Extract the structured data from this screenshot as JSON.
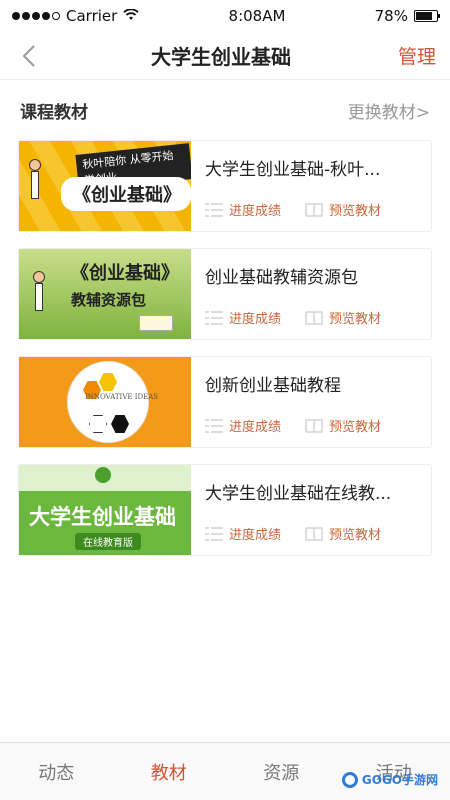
{
  "status": {
    "carrier": "Carrier",
    "time": "8:08AM",
    "battery": "78%",
    "battery_level": 0.78
  },
  "nav": {
    "title": "大学生创业基础",
    "manage": "管理"
  },
  "section": {
    "title": "课程教材",
    "switch": "更换教材>"
  },
  "actions": {
    "progress": "进度成绩",
    "preview": "预览教材"
  },
  "books": [
    {
      "title": "大学生创业基础-秋叶...",
      "cover_banner": "秋叶陪你 从零开始学创业",
      "cover_badge": "《创业基础》"
    },
    {
      "title": "创业基础教辅资源包",
      "cover_line1": "《创业基础》",
      "cover_line2": "教辅资源包"
    },
    {
      "title": "创新创业基础教程",
      "cover_text": "INNOVATIVE IDEAS"
    },
    {
      "title": "大学生创业基础在线教...",
      "cover_main": "大学生创业基础",
      "cover_sub": "在线教育版"
    }
  ],
  "tabs": [
    {
      "label": "动态"
    },
    {
      "label": "教材"
    },
    {
      "label": "资源"
    },
    {
      "label": "活动"
    }
  ],
  "watermark": "GOGO手游网",
  "colors": {
    "accent": "#d9532f",
    "muted": "#999999"
  }
}
